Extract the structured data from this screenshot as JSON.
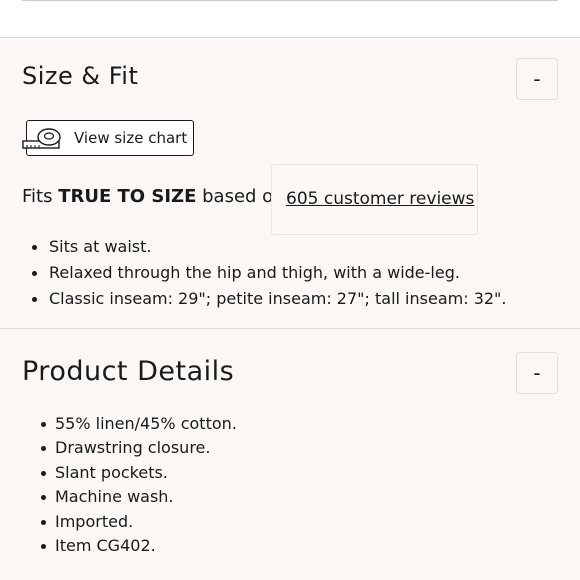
{
  "size_fit": {
    "title": "Size & Fit",
    "toggle_label": "-",
    "size_chart_button": "View size chart",
    "fits_prefix": "Fits ",
    "fits_emphasis": "TRUE TO SIZE",
    "fits_suffix": " based on",
    "reviews_link": "605 customer reviews",
    "bullets": [
      "Sits at waist.",
      "Relaxed through the hip and thigh, with a wide-leg.",
      "Classic inseam: 29\"; petite inseam: 27\"; tall inseam: 32\"."
    ]
  },
  "product_details": {
    "title": "Product Details",
    "toggle_label": "-",
    "bullets": [
      "55% linen/45% cotton.",
      "Drawstring closure.",
      "Slant pockets.",
      "Machine wash.",
      "Imported.",
      "Item CG402."
    ]
  },
  "icons": {
    "size_chart": "measuring-tape-icon"
  },
  "colors": {
    "background": "#faf7f4",
    "text": "#1a1a1a",
    "divider": "#dcd7d2"
  }
}
